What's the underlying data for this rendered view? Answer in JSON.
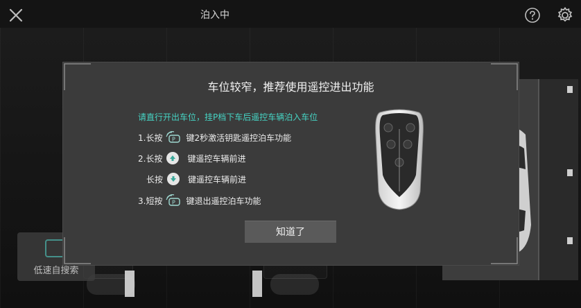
{
  "header": {
    "title": "泊入中"
  },
  "background": {
    "slow_search_label": "低速自搜索"
  },
  "dialog": {
    "title": "车位较窄，推荐使用遥控进出功能",
    "subtitle": "请直行开出车位，挂P档下车后遥控车辆泊入车位",
    "steps": [
      {
        "prefix": "1.长按",
        "icon": "remote-park-icon",
        "text": "键2秒激活钥匙遥控泊车功能"
      },
      {
        "prefix": "2.长按",
        "icon": "arrow-up-icon",
        "text": "键遥控车辆前进"
      },
      {
        "prefix": "长按",
        "icon": "arrow-down-icon",
        "text": "键遥控车辆前进"
      },
      {
        "prefix": "3.短按",
        "icon": "remote-park-icon",
        "text": "键退出遥控泊车功能"
      }
    ],
    "ok_label": "知道了"
  },
  "colors": {
    "accent": "#46d4c4",
    "dialog_bg": "#3b3b3b",
    "button_bg": "#5a5a5a",
    "page_bg": "#141414"
  }
}
